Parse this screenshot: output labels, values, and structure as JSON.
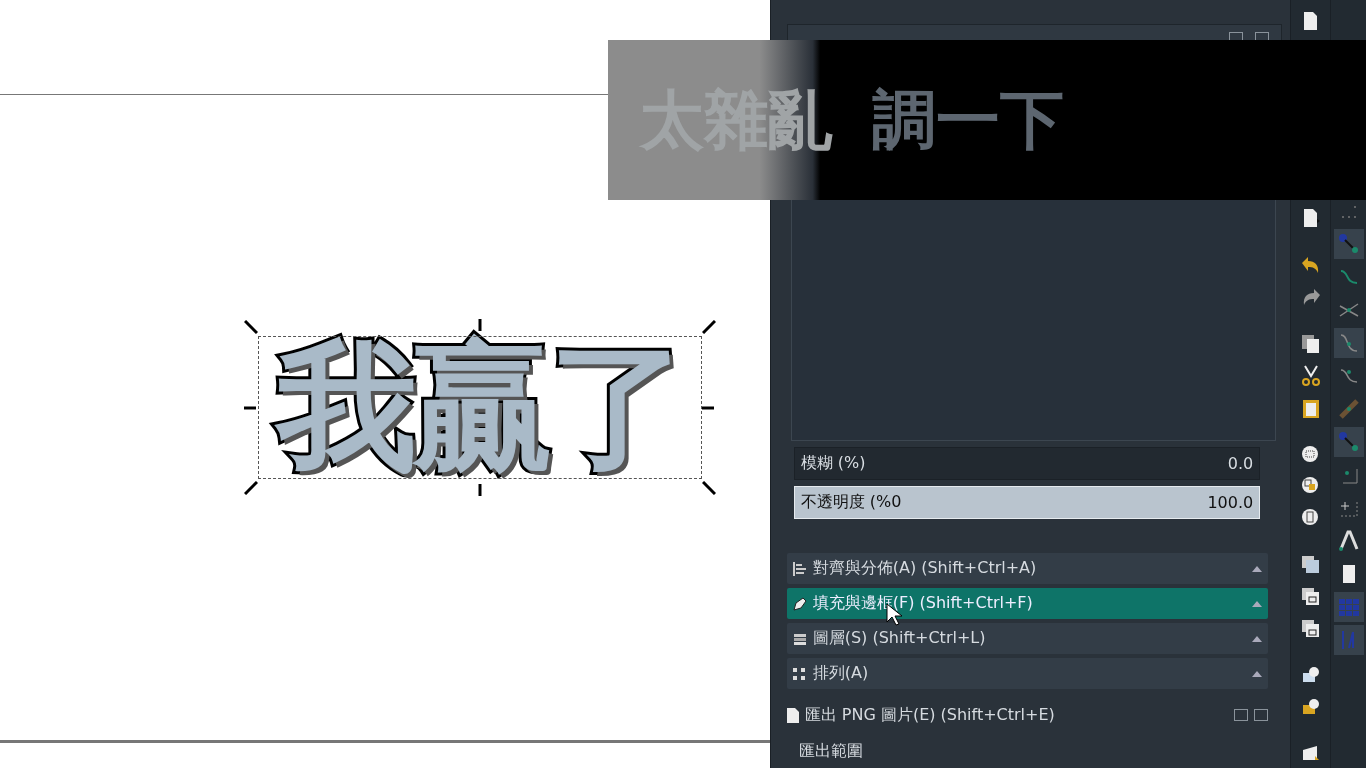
{
  "canvas": {
    "artwork_text": "我贏了",
    "selected": true
  },
  "caption": {
    "parts": [
      "太雜亂",
      "調一下"
    ]
  },
  "filter_fields": [
    {
      "label": "模糊 (%)",
      "value": "0.0",
      "focused": false
    },
    {
      "label": "不透明度 (%0",
      "value": "100.0",
      "focused": true
    }
  ],
  "docks": [
    {
      "kind": "align",
      "label": "對齊與分佈(A) (Shift+Ctrl+A)",
      "selected": false
    },
    {
      "kind": "fill",
      "label": "填充與邊框(F) (Shift+Ctrl+F)",
      "selected": true
    },
    {
      "kind": "layers",
      "label": "圖層(S) (Shift+Ctrl+L)",
      "selected": false
    },
    {
      "kind": "arrange",
      "label": "排列(A)",
      "selected": false
    }
  ],
  "export_dock": {
    "title": "匯出 PNG 圖片(E) (Shift+Ctrl+E)",
    "section": "匯出範圍"
  },
  "snap_toolbar": [
    {
      "on": false
    },
    {
      "on": true
    },
    {
      "on": false
    },
    {
      "on": false
    },
    {
      "on": true
    },
    {
      "on": false
    },
    {
      "on": false
    },
    {
      "on": true
    },
    {
      "on": false
    },
    {
      "on": false
    },
    {
      "on": false
    },
    {
      "on": false
    },
    {
      "on": true
    },
    {
      "on": true
    }
  ]
}
